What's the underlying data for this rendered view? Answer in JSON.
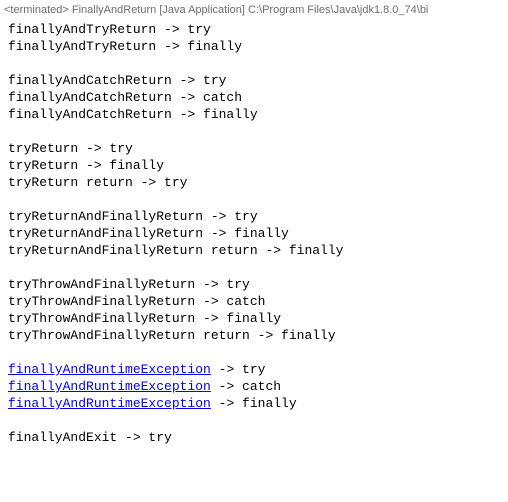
{
  "header": {
    "status": "<terminated>",
    "config_name": "FinallyAndReturn",
    "launch_type": "[Java Application]",
    "path": "C:\\Program Files\\Java\\jdk1.8.0_74\\bi"
  },
  "groups": [
    {
      "lines": [
        {
          "text": "finallyAndTryReturn -> try",
          "link": false
        },
        {
          "text": "finallyAndTryReturn -> finally",
          "link": false
        }
      ]
    },
    {
      "lines": [
        {
          "text": "finallyAndCatchReturn -> try",
          "link": false
        },
        {
          "text": "finallyAndCatchReturn -> catch",
          "link": false
        },
        {
          "text": "finallyAndCatchReturn -> finally",
          "link": false
        }
      ]
    },
    {
      "lines": [
        {
          "text": "tryReturn -> try",
          "link": false
        },
        {
          "text": "tryReturn -> finally",
          "link": false
        },
        {
          "text": "tryReturn return -> try",
          "link": false
        }
      ]
    },
    {
      "lines": [
        {
          "text": "tryReturnAndFinallyReturn -> try",
          "link": false
        },
        {
          "text": "tryReturnAndFinallyReturn -> finally",
          "link": false
        },
        {
          "text": "tryReturnAndFinallyReturn return -> finally",
          "link": false
        }
      ]
    },
    {
      "lines": [
        {
          "text": "tryThrowAndFinallyReturn -> try",
          "link": false
        },
        {
          "text": "tryThrowAndFinallyReturn -> catch",
          "link": false
        },
        {
          "text": "tryThrowAndFinallyReturn -> finally",
          "link": false
        },
        {
          "text": "tryThrowAndFinallyReturn return -> finally",
          "link": false
        }
      ]
    },
    {
      "lines": [
        {
          "link_text": "finallyAndRuntimeException",
          "suffix": " -> try",
          "link": true
        },
        {
          "link_text": "finallyAndRuntimeException",
          "suffix": " -> catch",
          "link": true
        },
        {
          "link_text": "finallyAndRuntimeException",
          "suffix": " -> finally",
          "link": true
        }
      ]
    },
    {
      "lines": [
        {
          "text": "finallyAndExit -> try",
          "link": false
        }
      ]
    }
  ]
}
